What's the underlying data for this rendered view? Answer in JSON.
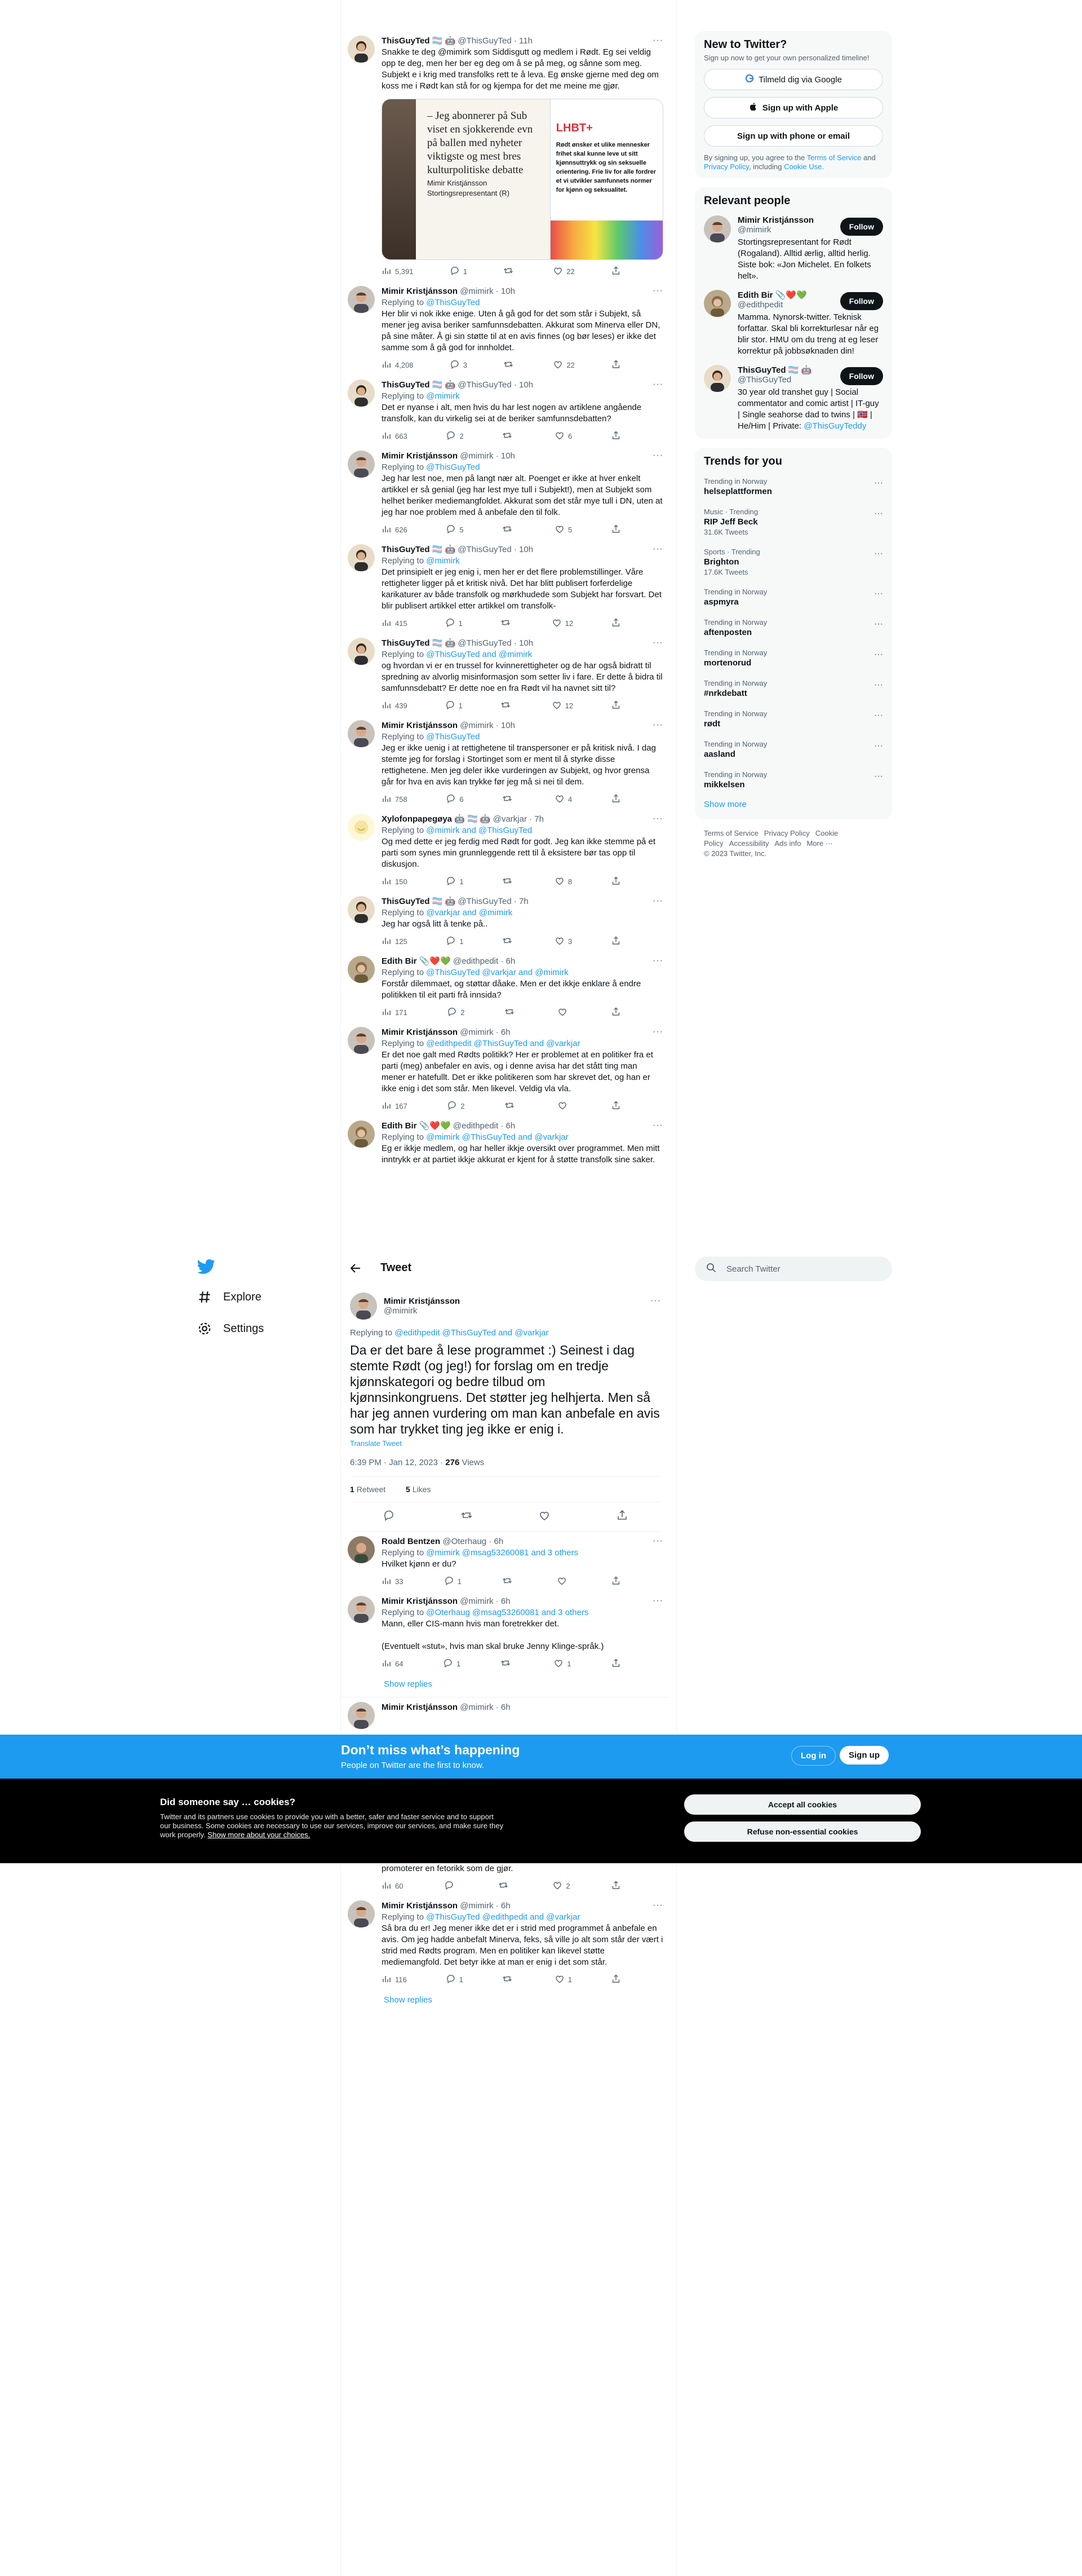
{
  "upper_thread": [
    {
      "name": "ThisGuyTed 🏳️‍⚧️ 🤖",
      "handle": "@ThisGuyTed",
      "time": "· 11h",
      "reply_to": "",
      "text": "Snakke te deg @mimirk som Siddisgutt og medlem i Rødt. Eg sei veldig opp te deg, men her ber eg deg om å se på meg, og sånne som meg. Subjekt e i krig med transfolks rett te å leva. Eg ønske gjerne med deg om koss me i Rødt kan stå for og kjempa for det me meine me gjør.",
      "replies": "1",
      "retweets": "",
      "likes": "22",
      "views": "5,391",
      "has_media": true,
      "avatar": "ted"
    },
    {
      "name": "Mimir Kristjánsson",
      "handle": "@mimirk",
      "time": "· 10h",
      "reply_to": "@ThisGuyTed",
      "text": "Her blir vi nok ikke enige. Uten å gå god for det som står i Subjekt, så mener jeg avisa beriker samfunnsdebatten. Akkurat som Minerva eller DN, på sine måter. Å gi sin støtte til at en avis finnes (og bør leses) er ikke det samme som å gå god for innholdet.",
      "replies": "3",
      "retweets": "",
      "likes": "22",
      "views": "4,208",
      "has_media": false,
      "avatar": "mimir"
    },
    {
      "name": "ThisGuyTed 🏳️‍⚧️ 🤖",
      "handle": "@ThisGuyTed",
      "time": "· 10h",
      "reply_to": "@mimirk",
      "text": "Det er nyanse i alt, men hvis du har lest nogen av artiklene angående transfolk, kan du virkelig sei at de beriker samfunnsdebatten?",
      "replies": "2",
      "retweets": "",
      "likes": "6",
      "views": "663",
      "has_media": false,
      "avatar": "ted"
    },
    {
      "name": "Mimir Kristjánsson",
      "handle": "@mimirk",
      "time": "· 10h",
      "reply_to": "@ThisGuyTed",
      "text": "Jeg har lest noe, men på langt nær alt. Poenget er ikke at hver enkelt artikkel er så genial (jeg har lest mye tull i Subjekt!), men at Subjekt som helhet beriker mediemangfoldet. Akkurat som det står mye tull i DN, uten at jeg har noe problem med å anbefale den til folk.",
      "replies": "5",
      "retweets": "",
      "likes": "5",
      "views": "626",
      "has_media": false,
      "avatar": "mimir"
    },
    {
      "name": "ThisGuyTed 🏳️‍⚧️ 🤖",
      "handle": "@ThisGuyTed",
      "time": "· 10h",
      "reply_to": "@mimirk",
      "text": "Det prinsipielt er jeg enig i, men her er det flere problemstillinger. Våre rettigheter ligger på et kritisk nivå. Det har blitt publisert forferdelige karikaturer av både transfolk og mørkhudede som Subjekt har forsvart. Det blir publisert artikkel etter artikkel om transfolk-",
      "replies": "1",
      "retweets": "",
      "likes": "12",
      "views": "415",
      "has_media": false,
      "avatar": "ted"
    },
    {
      "name": "ThisGuyTed 🏳️‍⚧️ 🤖",
      "handle": "@ThisGuyTed",
      "time": "· 10h",
      "reply_to": "@ThisGuyTed and @mimirk",
      "text": "og hvordan vi er en trussel for kvinnerettigheter og de har også bidratt til spredning av alvorlig misinformasjon som setter liv i fare. Er dette å bidra til samfunnsdebatt? Er dette noe en fra Rødt vil ha navnet sitt til?",
      "replies": "1",
      "retweets": "",
      "likes": "12",
      "views": "439",
      "has_media": false,
      "avatar": "ted"
    },
    {
      "name": "Mimir Kristjánsson",
      "handle": "@mimirk",
      "time": "· 10h",
      "reply_to": "@ThisGuyTed",
      "text": "Jeg er ikke uenig i at rettighetene til transpersoner er på kritisk nivå. I dag stemte jeg for forslag i Stortinget som er ment til å styrke disse rettighetene. Men jeg deler ikke vurderingen av Subjekt, og hvor grensa går for hva en avis kan trykke før jeg må si nei til dem.",
      "replies": "6",
      "retweets": "",
      "likes": "4",
      "views": "758",
      "has_media": false,
      "avatar": "mimir"
    },
    {
      "name": "Xylofonpapegøya 🤖 🏳️‍⚧️ 🤖",
      "handle": "@varkjar",
      "time": "· 7h",
      "reply_to": "@mimirk and @ThisGuyTed",
      "text": "Og med dette er jeg ferdig med Rødt for godt. Jeg kan ikke stemme på et parti som synes min grunnleggende rett til å eksistere bør tas opp til diskusjon.",
      "replies": "1",
      "retweets": "",
      "likes": "8",
      "views": "150",
      "has_media": false,
      "avatar": "xylo"
    },
    {
      "name": "ThisGuyTed 🏳️‍⚧️ 🤖",
      "handle": "@ThisGuyTed",
      "time": "· 7h",
      "reply_to": "@varkjar and @mimirk",
      "text": "Jeg har også litt å tenke på..",
      "replies": "1",
      "retweets": "",
      "likes": "3",
      "views": "125",
      "has_media": false,
      "avatar": "ted"
    },
    {
      "name": "Edith Bir 📎❤️💚",
      "handle": "@edithpedit",
      "time": "· 6h",
      "reply_to": "@ThisGuyTed @varkjar and @mimirk",
      "text": "Forstår dilemmaet, og støttar dåake. Men er det ikkje enklare å endre politikken til eit parti frå innsida?",
      "replies": "2",
      "retweets": "",
      "likes": "",
      "views": "171",
      "has_media": false,
      "avatar": "edith"
    },
    {
      "name": "Mimir Kristjánsson",
      "handle": "@mimirk",
      "time": "· 6h",
      "reply_to": "@edithpedit @ThisGuyTed and @varkjar",
      "text": "Er det noe galt med Rødts politikk? Her er problemet at en politiker fra et parti (meg) anbefaler en avis, og i denne avisa har det stått ting man mener er hatefullt. Det er ikke politikeren som har skrevet det, og han er ikke enig i det som står. Men likevel. Veldig vla vla.",
      "replies": "2",
      "retweets": "",
      "likes": "",
      "views": "167",
      "has_media": false,
      "avatar": "mimir"
    },
    {
      "name": "Edith Bir 📎❤️💚",
      "handle": "@edithpedit",
      "time": "· 6h",
      "reply_to": "@mimirk @ThisGuyTed and @varkjar",
      "text": "Eg er ikkje medlem, og har heller ikkje oversikt over programmet. Men mitt inntrykk er at partiet ikkje akkurat er kjent for å støtte transfolk sine saker. Men det veit du betre enn meg.",
      "replies": "",
      "retweets": "",
      "likes": "",
      "views": "",
      "has_media": false,
      "avatar": "edith"
    }
  ],
  "media_card": {
    "quote": "– Jeg abonnerer på Sub\nviset en sjokkerende evn\npå ballen med nyheter\nviktigste og mest bres\nkulturpolitiske debatte",
    "signature": "Mimir Kristjánsson\nStortingsrepresentant (R)",
    "label": "LHBT+",
    "desc": "Rødt ønsker et ulike mennesker frihet skal kunne leve ut sitt kjønnsuttrykk og sin seksuelle orientering. Frie liv for alle fordrer et vi utvikler samfunnets normer for kjønn og seksualitet."
  },
  "nav": {
    "explore": "Explore",
    "settings": "Settings"
  },
  "main_header": {
    "title": "Tweet"
  },
  "focus_tweet": {
    "name": "Mimir Kristjánsson",
    "handle": "@mimirk",
    "reply_prefix": "Replying to ",
    "reply_to": "@edithpedit @ThisGuyTed and @varkjar",
    "text": "Da er det bare å lese programmet :) Seinest i dag stemte Rødt (og jeg!) for forslag om en tredje kjønnskategori og bedre tilbud om kjønnsinkongruens. Det støtter jeg helhjerta. Men så har jeg annen vurdering om man kan anbefale en avis som har trykket ting jeg ikke er enig i.",
    "translate": "Translate Tweet",
    "date": "6:39 PM · Jan 12, 2023 · ",
    "views": "276",
    "views_label": " Views",
    "retweets": "1",
    "retweets_label": "Retweet",
    "likes": "5",
    "likes_label": "Likes"
  },
  "replies_main": [
    {
      "name": "Roald Bentzen",
      "handle": "@Oterhaug",
      "time": "· 6h",
      "reply_to": "@mimirk @msag53260081 and 3 others",
      "text": "Hvilket kjønn er du?",
      "replies": "1",
      "likes": "",
      "views": "33",
      "avatar": "roald"
    },
    {
      "name": "Mimir Kristjánsson",
      "handle": "@mimirk",
      "time": "· 6h",
      "reply_to": "@Oterhaug @msag53260081 and 3 others",
      "text": "Mann, eller CIS-mann hvis man foretrekker det.\n\n(Eventuelt «stut», hvis man skal bruke Jenny Klinge-språk.)",
      "replies": "1",
      "likes": "1",
      "views": "64",
      "avatar": "mimir"
    }
  ],
  "show_replies": "Show replies",
  "partial_reply": {
    "name": "Mimir Kristjánsson",
    "handle": "@mimirk",
    "time": "· 6h"
  },
  "lower_partial": {
    "text": "promoterer en fetorikk som de gjør.",
    "replies": "",
    "likes": "2",
    "views": "60"
  },
  "lower_reply": {
    "name": "Mimir Kristjánsson",
    "handle": "@mimirk",
    "time": "· 6h",
    "reply_to": "@ThisGuyTed @edithpedit and @varkjar",
    "text": "Så bra du er! Jeg mener ikke det er i strid med programmet å anbefale en avis. Om jeg hadde anbefalt Minerva, feks, så ville jo alt som står der vært i strid med Rødts program. Men en politiker kan likevel støtte mediemangfold. Det betyr ikke at man er enig i det som står.",
    "replies": "1",
    "likes": "1",
    "views": "116"
  },
  "new_to_twitter": {
    "title": "New to Twitter?",
    "subtitle": "Sign up now to get your own personalized timeline!",
    "google": "Tilmeld dig via Google",
    "apple": "Sign up with Apple",
    "phone": "Sign up with phone or email",
    "terms_pre": "By signing up, you agree to the ",
    "terms": "Terms of Service",
    "terms_mid": " and ",
    "privacy": "Privacy Policy",
    "terms_mid2": ", including ",
    "cookie": "Cookie Use",
    "terms_end": "."
  },
  "relevant_people": {
    "title": "Relevant people",
    "follow_label": "Follow",
    "people": [
      {
        "name": "Mimir Kristjánsson",
        "handle": "@mimirk",
        "bio": "Stortingsrepresentant for Rødt (Rogaland). Alltid ærlig, alltid herlig. Siste bok: «Jon Michelet. En folkets helt».",
        "avatar": "mimir"
      },
      {
        "name": "Edith Bir 📎❤️💚",
        "handle": "@edithpedit",
        "bio": "Mamma. Nynorsk-twitter. Teknisk forfattar. Skal bli korrekturlesar når eg blir stor. HMU om du treng at eg leser korrektur på jobbsøknaden din!",
        "avatar": "edith"
      },
      {
        "name": "ThisGuyTed 🏳️‍⚧️ 🤖",
        "handle": "@ThisGuyTed",
        "bio": "30 year old transhet guy | Social commentator and comic artist | IT-guy | Single seahorse dad to twins | 🇳🇴 | He/Him | Private: ",
        "bio_link": "@ThisGuyTeddy",
        "avatar": "ted"
      }
    ]
  },
  "trends": {
    "title": "Trends for you",
    "items": [
      {
        "context": "Trending in Norway",
        "name": "helseplattformen",
        "tweets": ""
      },
      {
        "context": "Music · Trending",
        "name": "RIP Jeff Beck",
        "tweets": "31.6K Tweets"
      },
      {
        "context": "Sports · Trending",
        "name": "Brighton",
        "tweets": "17.6K Tweets"
      },
      {
        "context": "Trending in Norway",
        "name": "aspmyra",
        "tweets": ""
      },
      {
        "context": "Trending in Norway",
        "name": "aftenposten",
        "tweets": ""
      },
      {
        "context": "Trending in Norway",
        "name": "mortenorud",
        "tweets": ""
      },
      {
        "context": "Trending in Norway",
        "name": "#nrkdebatt",
        "tweets": ""
      },
      {
        "context": "Trending in Norway",
        "name": "rødt",
        "tweets": ""
      },
      {
        "context": "Trending in Norway",
        "name": "aasland",
        "tweets": ""
      },
      {
        "context": "Trending in Norway",
        "name": "mikkelsen",
        "tweets": ""
      }
    ],
    "show_more": "Show more"
  },
  "footer": {
    "items": [
      "Terms of Service",
      "Privacy Policy",
      "Cookie Policy",
      "Accessibility",
      "Ads info",
      "More ···"
    ],
    "copyright": "© 2023 Twitter, Inc."
  },
  "search": {
    "placeholder": "Search Twitter"
  },
  "login_banner": {
    "title": "Don’t miss what’s happening",
    "subtitle": "People on Twitter are the first to know.",
    "login": "Log in",
    "signup": "Sign up"
  },
  "cookie_banner": {
    "title": "Did someone say … cookies?",
    "body": "Twitter and its partners use cookies to provide you with a better, safer and faster service and to support our business. Some cookies are necessary to use our services, improve our services, and make sure they work properly. ",
    "link": "Show more about your choices.",
    "accept": "Accept all cookies",
    "refuse": "Refuse non-essential cookies"
  },
  "colors": {
    "accent": "#1d9bf0",
    "text": "#0f1419",
    "muted": "#536471"
  }
}
